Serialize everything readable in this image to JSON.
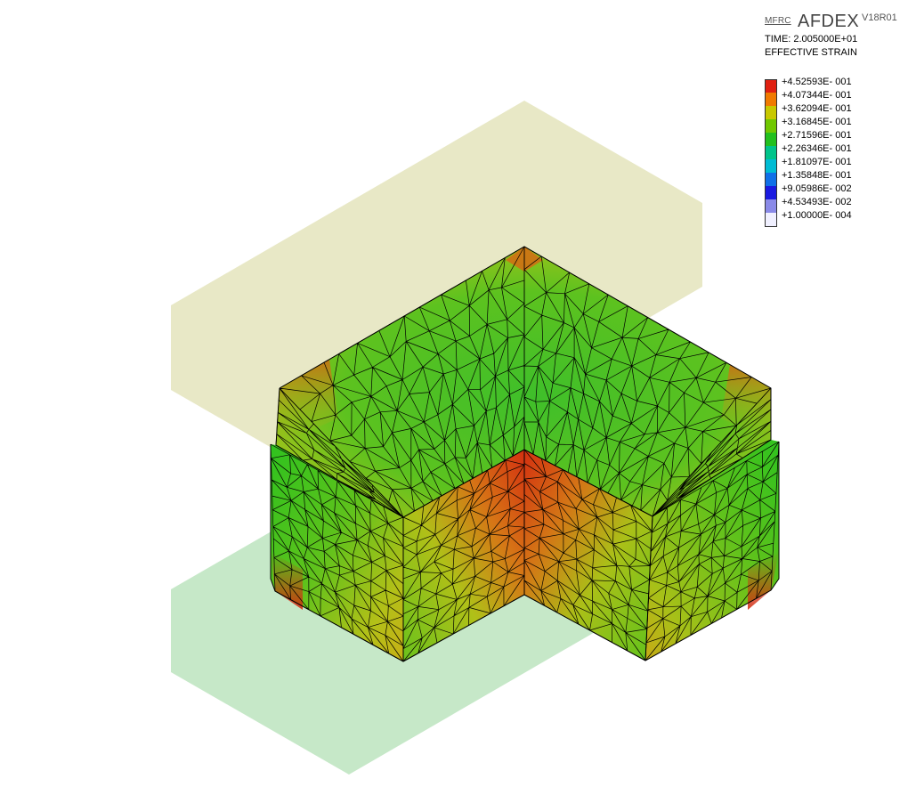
{
  "header": {
    "brand_small": "MFRC",
    "brand_name": "AFDEX",
    "version": "V18R01",
    "time_label": "TIME: 2.005000E+01",
    "variable_label": "EFFECTIVE STRAIN"
  },
  "legend": {
    "levels": [
      {
        "label": "+4.52593E- 001",
        "color": "#e02010"
      },
      {
        "label": "+4.07344E- 001",
        "color": "#f07a00"
      },
      {
        "label": "+3.62094E- 001",
        "color": "#c8c800"
      },
      {
        "label": "+3.16845E- 001",
        "color": "#70c800"
      },
      {
        "label": "+2.71596E- 001",
        "color": "#22c01e"
      },
      {
        "label": "+2.26346E- 001",
        "color": "#00c48a"
      },
      {
        "label": "+1.81097E- 001",
        "color": "#00bcd4"
      },
      {
        "label": "+1.35848E- 001",
        "color": "#1070e8"
      },
      {
        "label": "+9.05986E- 002",
        "color": "#1a1ae0"
      },
      {
        "label": "+4.53493E- 002",
        "color": "#8a8ae8"
      },
      {
        "label": "+1.00000E- 004",
        "color": "#f0f0ff"
      }
    ]
  },
  "scene": {
    "upper_die_color": "#e8e8c6",
    "lower_die_color": "#c6e8c8",
    "mesh_line_color": "#000000"
  }
}
